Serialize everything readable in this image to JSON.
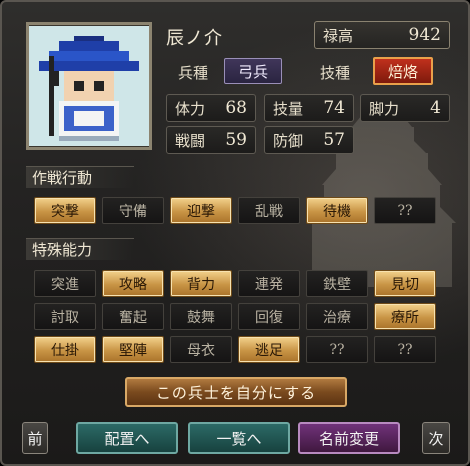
{
  "unit": {
    "name": "辰ノ介",
    "wealth_label": "禄高",
    "wealth_value": "942",
    "troop_type_label": "兵種",
    "troop_type_value": "弓兵",
    "skill_type_label": "技種",
    "skill_type_value": "焙烙"
  },
  "stats": [
    {
      "label": "体力",
      "value": "68"
    },
    {
      "label": "技量",
      "value": "74"
    },
    {
      "label": "脚力",
      "value": "4"
    },
    {
      "label": "戦闘",
      "value": "59"
    },
    {
      "label": "防御",
      "value": "57"
    }
  ],
  "tactics": {
    "header": "作戦行動",
    "items": [
      {
        "label": "突撃",
        "active": true
      },
      {
        "label": "守備",
        "active": false
      },
      {
        "label": "迎撃",
        "active": true
      },
      {
        "label": "乱戦",
        "active": false
      },
      {
        "label": "待機",
        "active": true
      },
      {
        "label": "??",
        "active": false
      }
    ]
  },
  "abilities": {
    "header": "特殊能力",
    "items": [
      {
        "label": "突進",
        "active": false
      },
      {
        "label": "攻略",
        "active": true
      },
      {
        "label": "背力",
        "active": true
      },
      {
        "label": "連発",
        "active": false
      },
      {
        "label": "鉄壁",
        "active": false
      },
      {
        "label": "見切",
        "active": true
      },
      {
        "label": "討取",
        "active": false
      },
      {
        "label": "奮起",
        "active": false
      },
      {
        "label": "鼓舞",
        "active": false
      },
      {
        "label": "回復",
        "active": false
      },
      {
        "label": "治療",
        "active": false
      },
      {
        "label": "療所",
        "active": true
      },
      {
        "label": "仕掛",
        "active": true
      },
      {
        "label": "堅陣",
        "active": true
      },
      {
        "label": "母衣",
        "active": false
      },
      {
        "label": "逃足",
        "active": true
      },
      {
        "label": "??",
        "active": false
      },
      {
        "label": "??",
        "active": false
      }
    ]
  },
  "actions": {
    "make_own": "この兵士を自分にする",
    "prev": "前",
    "placement": "配置へ",
    "list": "一覧へ",
    "rename": "名前変更",
    "next": "次"
  },
  "colors": {
    "active_button": "#c89445",
    "skill_highlight": "#c0301c",
    "troop_tag": "#40365a",
    "nav_teal": "#2c6a66",
    "nav_purple": "#70327a"
  }
}
